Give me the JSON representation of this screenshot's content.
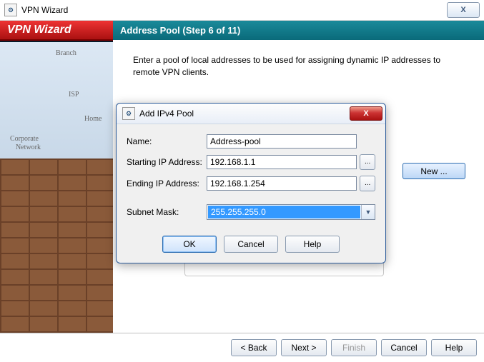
{
  "window": {
    "title": "VPN Wizard",
    "close": "X"
  },
  "sidebar": {
    "title": "VPN Wizard",
    "labels": {
      "branch": "Branch",
      "isp": "ISP",
      "home": "Home",
      "corp1": "Corporate",
      "corp2": "Network"
    }
  },
  "step": {
    "header": "Address Pool  (Step 6 of 11)",
    "instruction": "Enter a pool of local addresses to be used for assigning dynamic IP addresses to remote VPN clients.",
    "new_button": "New ...",
    "ghost_label": "Subnet Mask:"
  },
  "dialog": {
    "title": "Add IPv4 Pool",
    "close": "X",
    "fields": {
      "name_label": "Name:",
      "name_value": "Address-pool",
      "start_label": "Starting IP Address:",
      "start_value": "192.168.1.1",
      "end_label": "Ending IP Address:",
      "end_value": "192.168.1.254",
      "mask_label": "Subnet Mask:",
      "mask_value": "255.255.255.0"
    },
    "buttons": {
      "ok": "OK",
      "cancel": "Cancel",
      "help": "Help"
    }
  },
  "footer": {
    "back": "< Back",
    "next": "Next >",
    "finish": "Finish",
    "cancel": "Cancel",
    "help": "Help"
  }
}
